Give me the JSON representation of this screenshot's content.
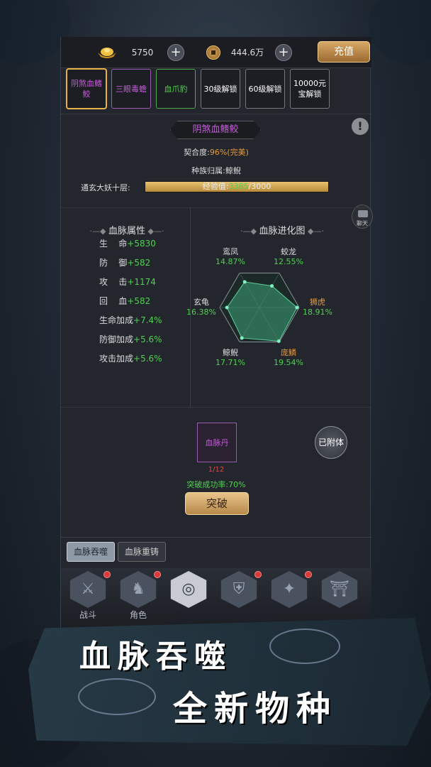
{
  "topbar": {
    "ingot_value": "5750",
    "coin_value": "444.6万",
    "plus_symbol": "+",
    "recharge_label": "充值"
  },
  "slots": [
    {
      "label": "阴煞血鳍鲛",
      "color": "#c35cd8",
      "border": "#e8b14a"
    },
    {
      "label": "三眼毒蟾",
      "color": "#c35cd8",
      "border": "#9a5ab2"
    },
    {
      "label": "血爪豹",
      "color": "#4fd14f",
      "border": "#4fa84f"
    },
    {
      "label": "30级解锁",
      "color": "#ffffff",
      "border": "#777777"
    },
    {
      "label": "60级解锁",
      "color": "#ffffff",
      "border": "#777777"
    },
    {
      "label": "10000元宝解锁",
      "color": "#ffffff",
      "border": "#777777"
    }
  ],
  "bloodline": {
    "name": "阴煞血鳍鲛",
    "compat_label": "契合度:",
    "compat_value": "96%(完美)",
    "race_line": "种族归属:鲸鲵",
    "realm_label": "通玄大妖十层:",
    "exp_prefix": "经验值:",
    "exp_current": "3385",
    "exp_sep": "/",
    "exp_max": "3000",
    "exp_fraction": 1.0,
    "info_symbol": "!",
    "chat_label": "聊天"
  },
  "attributes": {
    "title": "血脉属性",
    "rows": [
      {
        "name": "生    命",
        "value": "+5830"
      },
      {
        "name": "防    御",
        "value": "+582"
      },
      {
        "name": "攻    击",
        "value": "+1174"
      },
      {
        "name": "回    血",
        "value": "+582"
      },
      {
        "name": "生命加成",
        "value": "+7.4%"
      },
      {
        "name": "防御加成",
        "value": "+5.6%"
      },
      {
        "name": "攻击加成",
        "value": "+5.6%"
      }
    ]
  },
  "evolution": {
    "title": "血脉进化图",
    "axes": [
      {
        "name": "蛟龙",
        "value": "12.55%",
        "pct": 12.55
      },
      {
        "name": "狮虎",
        "value": "18.91%",
        "pct": 18.91
      },
      {
        "name": "庞鳞",
        "value": "19.54%",
        "pct": 19.54
      },
      {
        "name": "鲸鲵",
        "value": "17.71%",
        "pct": 17.71
      },
      {
        "name": "玄龟",
        "value": "16.38%",
        "pct": 16.38
      },
      {
        "name": "鸾凤",
        "value": "14.87%",
        "pct": 14.87
      }
    ],
    "highlight_color": "#e59a3c"
  },
  "breakthrough": {
    "pill_label": "血脉丹",
    "pill_count": "1/12",
    "rate_label": "突破成功率:70%",
    "button_label": "突破",
    "attached_label": "已附体"
  },
  "tabs": [
    {
      "label": "血脉吞噬",
      "active": true
    },
    {
      "label": "血脉重铸",
      "active": false
    }
  ],
  "nav": [
    {
      "label": "战斗",
      "glyph": "⚔",
      "dot": true
    },
    {
      "label": "角色",
      "glyph": "♞",
      "dot": true
    },
    {
      "label": "",
      "glyph": "◎",
      "dot": false
    },
    {
      "label": "",
      "glyph": "⛨",
      "dot": true
    },
    {
      "label": "",
      "glyph": "✦",
      "dot": true
    },
    {
      "label": "",
      "glyph": "⛩",
      "dot": false
    }
  ],
  "banner": {
    "line1": "血脉吞噬",
    "line2": "全新物种"
  }
}
